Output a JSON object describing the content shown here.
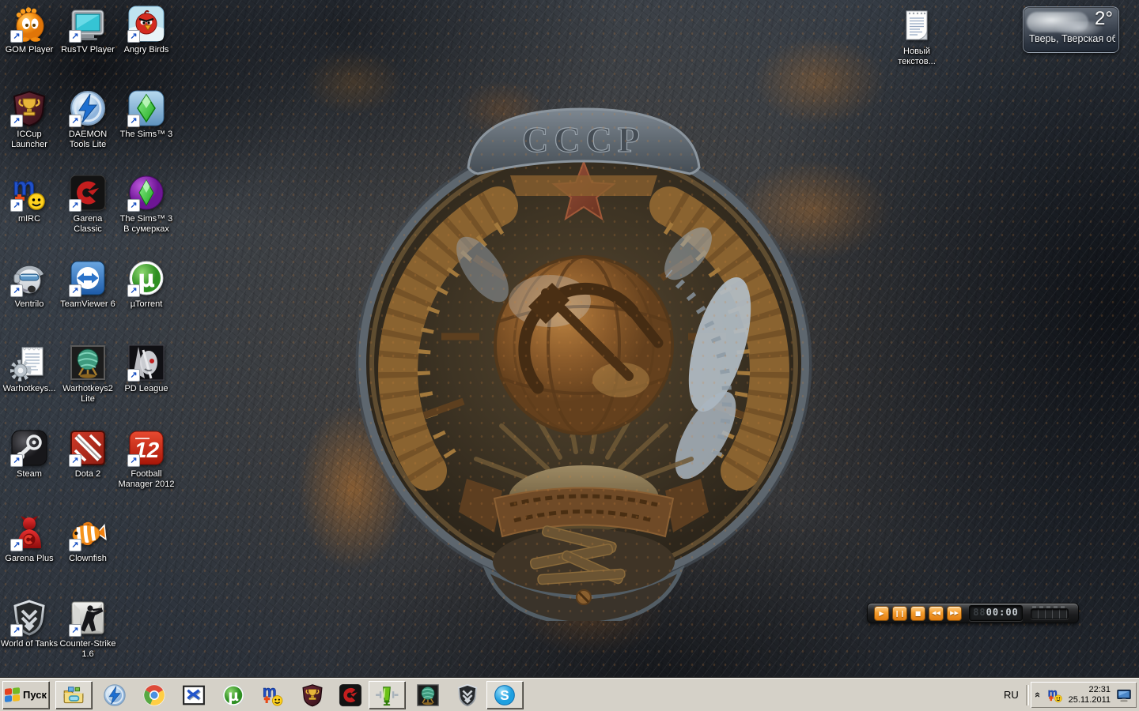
{
  "wallpaper": {
    "emblem_text": "СССР"
  },
  "desktop_icons": [
    {
      "id": "gom-player",
      "label": "GOM Player",
      "icon": "gom",
      "col": 0,
      "row": 0,
      "shortcut": true
    },
    {
      "id": "rustv-player",
      "label": "RusTV Player",
      "icon": "rustv",
      "col": 1,
      "row": 0,
      "shortcut": true
    },
    {
      "id": "angry-birds",
      "label": "Angry Birds",
      "icon": "angry",
      "col": 2,
      "row": 0,
      "shortcut": true
    },
    {
      "id": "iccup-launcher",
      "label": "ICCup Launcher",
      "icon": "iccup",
      "col": 0,
      "row": 1,
      "shortcut": true
    },
    {
      "id": "daemon-tools-lite",
      "label": "DAEMON Tools Lite",
      "icon": "daemon",
      "col": 1,
      "row": 1,
      "shortcut": true
    },
    {
      "id": "the-sims-3",
      "label": "The Sims™ 3",
      "icon": "sims3",
      "col": 2,
      "row": 1,
      "shortcut": true
    },
    {
      "id": "mirc",
      "label": "mIRC",
      "icon": "mirc",
      "col": 0,
      "row": 2,
      "shortcut": true
    },
    {
      "id": "garena-classic",
      "label": "Garena Classic",
      "icon": "garena",
      "col": 1,
      "row": 2,
      "shortcut": true
    },
    {
      "id": "the-sims-3-dusk",
      "label": "The Sims™ 3 В сумерках",
      "icon": "sims3dark",
      "col": 2,
      "row": 2,
      "shortcut": true
    },
    {
      "id": "ventrilo",
      "label": "Ventrilo",
      "icon": "ventrilo",
      "col": 0,
      "row": 3,
      "shortcut": true
    },
    {
      "id": "teamviewer-6",
      "label": "TeamViewer 6",
      "icon": "teamviewer",
      "col": 1,
      "row": 3,
      "shortcut": true
    },
    {
      "id": "utorrent",
      "label": "µTorrent",
      "icon": "utorrent",
      "col": 2,
      "row": 3,
      "shortcut": true
    },
    {
      "id": "warhotkeys",
      "label": "Warhotkeys...",
      "icon": "warhotkeys1",
      "col": 0,
      "row": 4,
      "shortcut": false
    },
    {
      "id": "warhotkeys2-lite",
      "label": "Warhotkeys2 Lite",
      "icon": "warhotkeys2",
      "col": 1,
      "row": 4,
      "shortcut": false
    },
    {
      "id": "pd-league",
      "label": "PD League",
      "icon": "pdleague",
      "col": 2,
      "row": 4,
      "shortcut": true
    },
    {
      "id": "steam",
      "label": "Steam",
      "icon": "steam",
      "col": 0,
      "row": 5,
      "shortcut": true
    },
    {
      "id": "dota-2",
      "label": "Dota 2",
      "icon": "dota2",
      "col": 1,
      "row": 5,
      "shortcut": true
    },
    {
      "id": "football-manager-2012",
      "label": "Football Manager 2012",
      "icon": "fm12",
      "col": 2,
      "row": 5,
      "shortcut": true
    },
    {
      "id": "garena-plus",
      "label": "Garena Plus",
      "icon": "garenaplus",
      "col": 0,
      "row": 6,
      "shortcut": true
    },
    {
      "id": "clownfish",
      "label": "Clownfish",
      "icon": "clownfish",
      "col": 1,
      "row": 6,
      "shortcut": true
    },
    {
      "id": "world-of-tanks",
      "label": "World of Tanks",
      "icon": "wot",
      "col": 0,
      "row": 7,
      "shortcut": true
    },
    {
      "id": "counter-strike-16",
      "label": "Counter-Strike 1.6",
      "icon": "cs16",
      "col": 1,
      "row": 7,
      "shortcut": true
    }
  ],
  "new_text_document": {
    "label": "Новый текстов...",
    "icon": "textdoc"
  },
  "gadgets": {
    "weather": {
      "temperature": "2°",
      "location": "Тверь, Тверская об...",
      "condition": "cloudy"
    },
    "media_player": {
      "time_display": "00:00",
      "time_dim_prefix": "88",
      "buttons": [
        {
          "id": "play",
          "glyph": "▶"
        },
        {
          "id": "pause",
          "glyph": "❙❙"
        },
        {
          "id": "stop",
          "glyph": "■"
        },
        {
          "id": "rewind",
          "glyph": "◀◀"
        },
        {
          "id": "fast-forward",
          "glyph": "▶▶"
        }
      ]
    }
  },
  "taskbar": {
    "start": {
      "label": "Пуск"
    },
    "items": [
      {
        "id": "explorer-folder",
        "icon": "folder",
        "active": true
      },
      {
        "id": "daemon-tools",
        "icon": "daemon",
        "active": false
      },
      {
        "id": "chrome",
        "icon": "chrome",
        "active": false
      },
      {
        "id": "xfire",
        "icon": "xfire",
        "active": false
      },
      {
        "id": "utorrent",
        "icon": "utorrent",
        "active": false
      },
      {
        "id": "mirc",
        "icon": "mirc",
        "active": false
      },
      {
        "id": "iccup",
        "icon": "iccup",
        "active": false
      },
      {
        "id": "garena",
        "icon": "garena",
        "active": false
      },
      {
        "id": "aimp",
        "icon": "aimp",
        "active": true
      },
      {
        "id": "warhotkeys2",
        "icon": "warhotkeys2",
        "active": false
      },
      {
        "id": "world-of-tanks",
        "icon": "wot",
        "active": false
      },
      {
        "id": "skype",
        "icon": "skype",
        "active": true
      }
    ],
    "tray": {
      "language": "RU",
      "icons": [
        "mirc"
      ],
      "clock": {
        "time": "22:31",
        "date": "25.11.2011"
      }
    }
  }
}
